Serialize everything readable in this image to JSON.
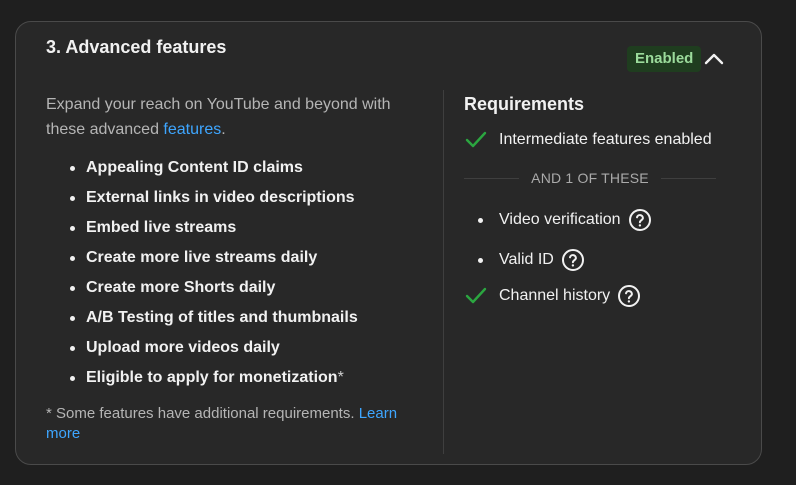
{
  "card": {
    "title": "3. Advanced features",
    "status_badge": "Enabled",
    "collapse_icon": "chevron-up-icon"
  },
  "intro": {
    "text_before": "Expand your reach on YouTube and beyond with these advanced ",
    "link": "features",
    "text_after": "."
  },
  "features": [
    {
      "label": "Appealing Content ID claims",
      "suffix": ""
    },
    {
      "label": "External links in video descriptions",
      "suffix": ""
    },
    {
      "label": "Embed live streams",
      "suffix": ""
    },
    {
      "label": "Create more live streams daily",
      "suffix": ""
    },
    {
      "label": "Create more Shorts daily",
      "suffix": ""
    },
    {
      "label": "A/B Testing of titles and thumbnails",
      "suffix": ""
    },
    {
      "label": "Upload more videos daily",
      "suffix": ""
    },
    {
      "label": "Eligible to apply for monetization",
      "suffix": "*"
    }
  ],
  "footnote": {
    "text": "* Some features have additional requirements. ",
    "link": "Learn more"
  },
  "requirements": {
    "title": "Requirements",
    "primary": {
      "label": "Intermediate features enabled",
      "status": "met"
    },
    "separator": "AND 1 OF THESE",
    "options": [
      {
        "label": "Video verification",
        "status": "unmet"
      },
      {
        "label": "Valid ID",
        "status": "unmet"
      },
      {
        "label": "Channel history",
        "status": "met"
      }
    ]
  },
  "colors": {
    "check": "#2ba640",
    "link": "#3ea6ff",
    "badge_bg": "#1f3d1f",
    "badge_text": "#9bdb9b"
  }
}
